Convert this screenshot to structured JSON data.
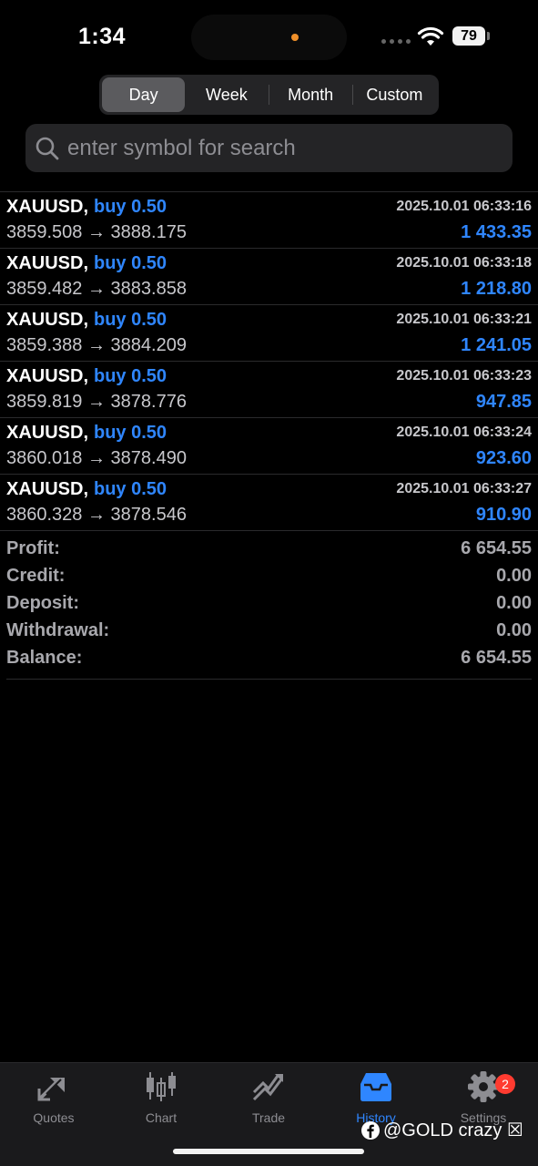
{
  "status_bar": {
    "time": "1:34",
    "battery": "79"
  },
  "period_tabs": [
    {
      "label": "Day",
      "active": true
    },
    {
      "label": "Week",
      "active": false
    },
    {
      "label": "Month",
      "active": false
    },
    {
      "label": "Custom",
      "active": false
    }
  ],
  "search": {
    "placeholder": "enter symbol for search",
    "value": ""
  },
  "deals": [
    {
      "symbol": "XAUUSD,",
      "side": "buy 0.50",
      "open_price": "3859.508",
      "close_price": "3888.175",
      "time": "2025.10.01 06:33:16",
      "profit": "1 433.35"
    },
    {
      "symbol": "XAUUSD,",
      "side": "buy 0.50",
      "open_price": "3859.482",
      "close_price": "3883.858",
      "time": "2025.10.01 06:33:18",
      "profit": "1 218.80"
    },
    {
      "symbol": "XAUUSD,",
      "side": "buy 0.50",
      "open_price": "3859.388",
      "close_price": "3884.209",
      "time": "2025.10.01 06:33:21",
      "profit": "1 241.05"
    },
    {
      "symbol": "XAUUSD,",
      "side": "buy 0.50",
      "open_price": "3859.819",
      "close_price": "3878.776",
      "time": "2025.10.01 06:33:23",
      "profit": "947.85"
    },
    {
      "symbol": "XAUUSD,",
      "side": "buy 0.50",
      "open_price": "3860.018",
      "close_price": "3878.490",
      "time": "2025.10.01 06:33:24",
      "profit": "923.60"
    },
    {
      "symbol": "XAUUSD,",
      "side": "buy 0.50",
      "open_price": "3860.328",
      "close_price": "3878.546",
      "time": "2025.10.01 06:33:27",
      "profit": "910.90"
    }
  ],
  "arrow": "→",
  "summary": [
    {
      "label": "Profit:",
      "value": "6 654.55"
    },
    {
      "label": "Credit:",
      "value": "0.00"
    },
    {
      "label": "Deposit:",
      "value": "0.00"
    },
    {
      "label": "Withdrawal:",
      "value": "0.00"
    },
    {
      "label": "Balance:",
      "value": "6 654.55"
    }
  ],
  "tabbar": [
    {
      "label": "Quotes",
      "icon": "quotes-icon",
      "active": false
    },
    {
      "label": "Chart",
      "icon": "candlestick-icon",
      "active": false
    },
    {
      "label": "Trade",
      "icon": "trade-icon",
      "active": false
    },
    {
      "label": "History",
      "icon": "inbox-icon",
      "active": true
    },
    {
      "label": "Settings",
      "icon": "gear-icon",
      "active": false,
      "badge": "2"
    }
  ],
  "watermark": "@GOLD crazy ☒",
  "colors": {
    "accent": "#2f86ff",
    "background": "#000000",
    "muted": "#8d8d92",
    "badge": "#ff3b30"
  }
}
